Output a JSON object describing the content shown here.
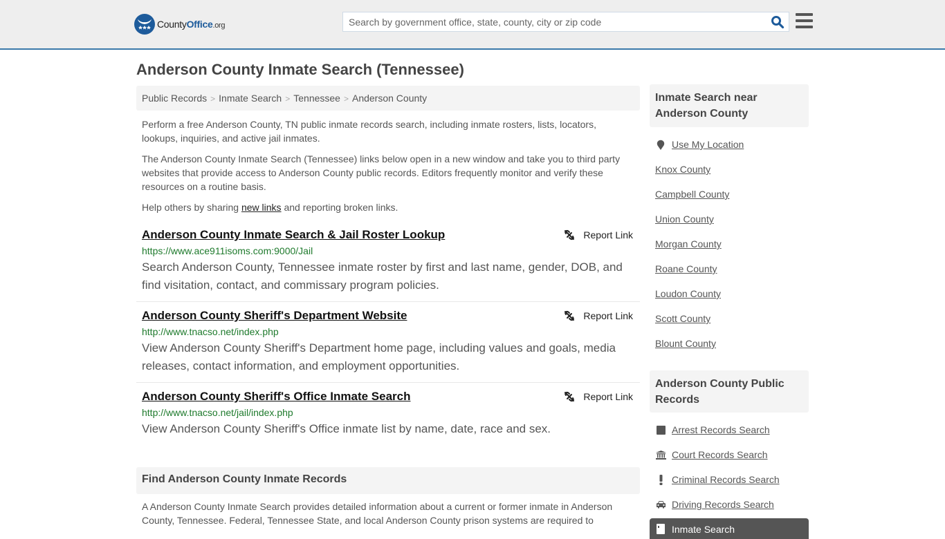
{
  "header": {
    "logo": {
      "county": "County",
      "office": "Office",
      "org": ".org"
    },
    "search": {
      "placeholder": "Search by government office, state, county, city or zip code",
      "value": ""
    },
    "icons": {
      "search": "search-icon",
      "menu": "hamburger-menu-icon"
    }
  },
  "page": {
    "title": "Anderson County Inmate Search (Tennessee)"
  },
  "breadcrumb": [
    "Public Records",
    "Inmate Search",
    "Tennessee",
    "Anderson County"
  ],
  "intro": {
    "p1": "Perform a free Anderson County, TN public inmate records search, including inmate rosters, lists, locators, lookups, inquiries, and active jail inmates.",
    "p2": "The Anderson County Inmate Search (Tennessee) links below open in a new window and take you to third party websites that provide access to Anderson County public records. Editors frequently monitor and verify these resources on a routine basis.",
    "p3_before": "Help others by sharing ",
    "p3_link": "new links",
    "p3_after": " and reporting broken links."
  },
  "results": [
    {
      "title": "Anderson County Inmate Search & Jail Roster Lookup",
      "url": "https://www.ace911isoms.com:9000/Jail",
      "description": "Search Anderson County, Tennessee inmate roster by first and last name, gender, DOB, and find visitation, contact, and commissary program policies.",
      "report_label": "Report Link"
    },
    {
      "title": "Anderson County Sheriff's Department Website",
      "url": "http://www.tnacso.net/index.php",
      "description": "View Anderson County Sheriff's Department home page, including values and goals, media releases, contact information, and employment opportunities.",
      "report_label": "Report Link"
    },
    {
      "title": "Anderson County Sheriff's Office Inmate Search",
      "url": "http://www.tnacso.net/jail/index.php",
      "description": "View Anderson County Sheriff's Office inmate list by name, date, race and sex.",
      "report_label": "Report Link"
    }
  ],
  "find_section": {
    "heading": "Find Anderson County Inmate Records",
    "text": "A Anderson County Inmate Search provides detailed information about a current or former inmate in Anderson County, Tennessee. Federal, Tennessee State, and local Anderson County prison systems are required to"
  },
  "sidebar": {
    "nearby": {
      "heading": "Inmate Search near Anderson County",
      "use_location": "Use My Location",
      "counties": [
        "Knox County",
        "Campbell County",
        "Union County",
        "Morgan County",
        "Roane County",
        "Loudon County",
        "Scott County",
        "Blount County"
      ]
    },
    "public_records": {
      "heading": "Anderson County Public Records",
      "items": [
        {
          "label": "Arrest Records Search",
          "icon": "square-icon"
        },
        {
          "label": "Court Records Search",
          "icon": "courthouse-icon"
        },
        {
          "label": "Criminal Records Search",
          "icon": "exclamation-icon"
        },
        {
          "label": "Driving Records Search",
          "icon": "car-icon"
        }
      ],
      "active_item": {
        "label": "Inmate Search",
        "icon": "inmate-door-icon"
      }
    }
  },
  "colors": {
    "brand_blue": "#1d5b9b",
    "header_border": "#3b79a9",
    "url_green": "#1e7a2c",
    "active_bg": "#555555"
  }
}
